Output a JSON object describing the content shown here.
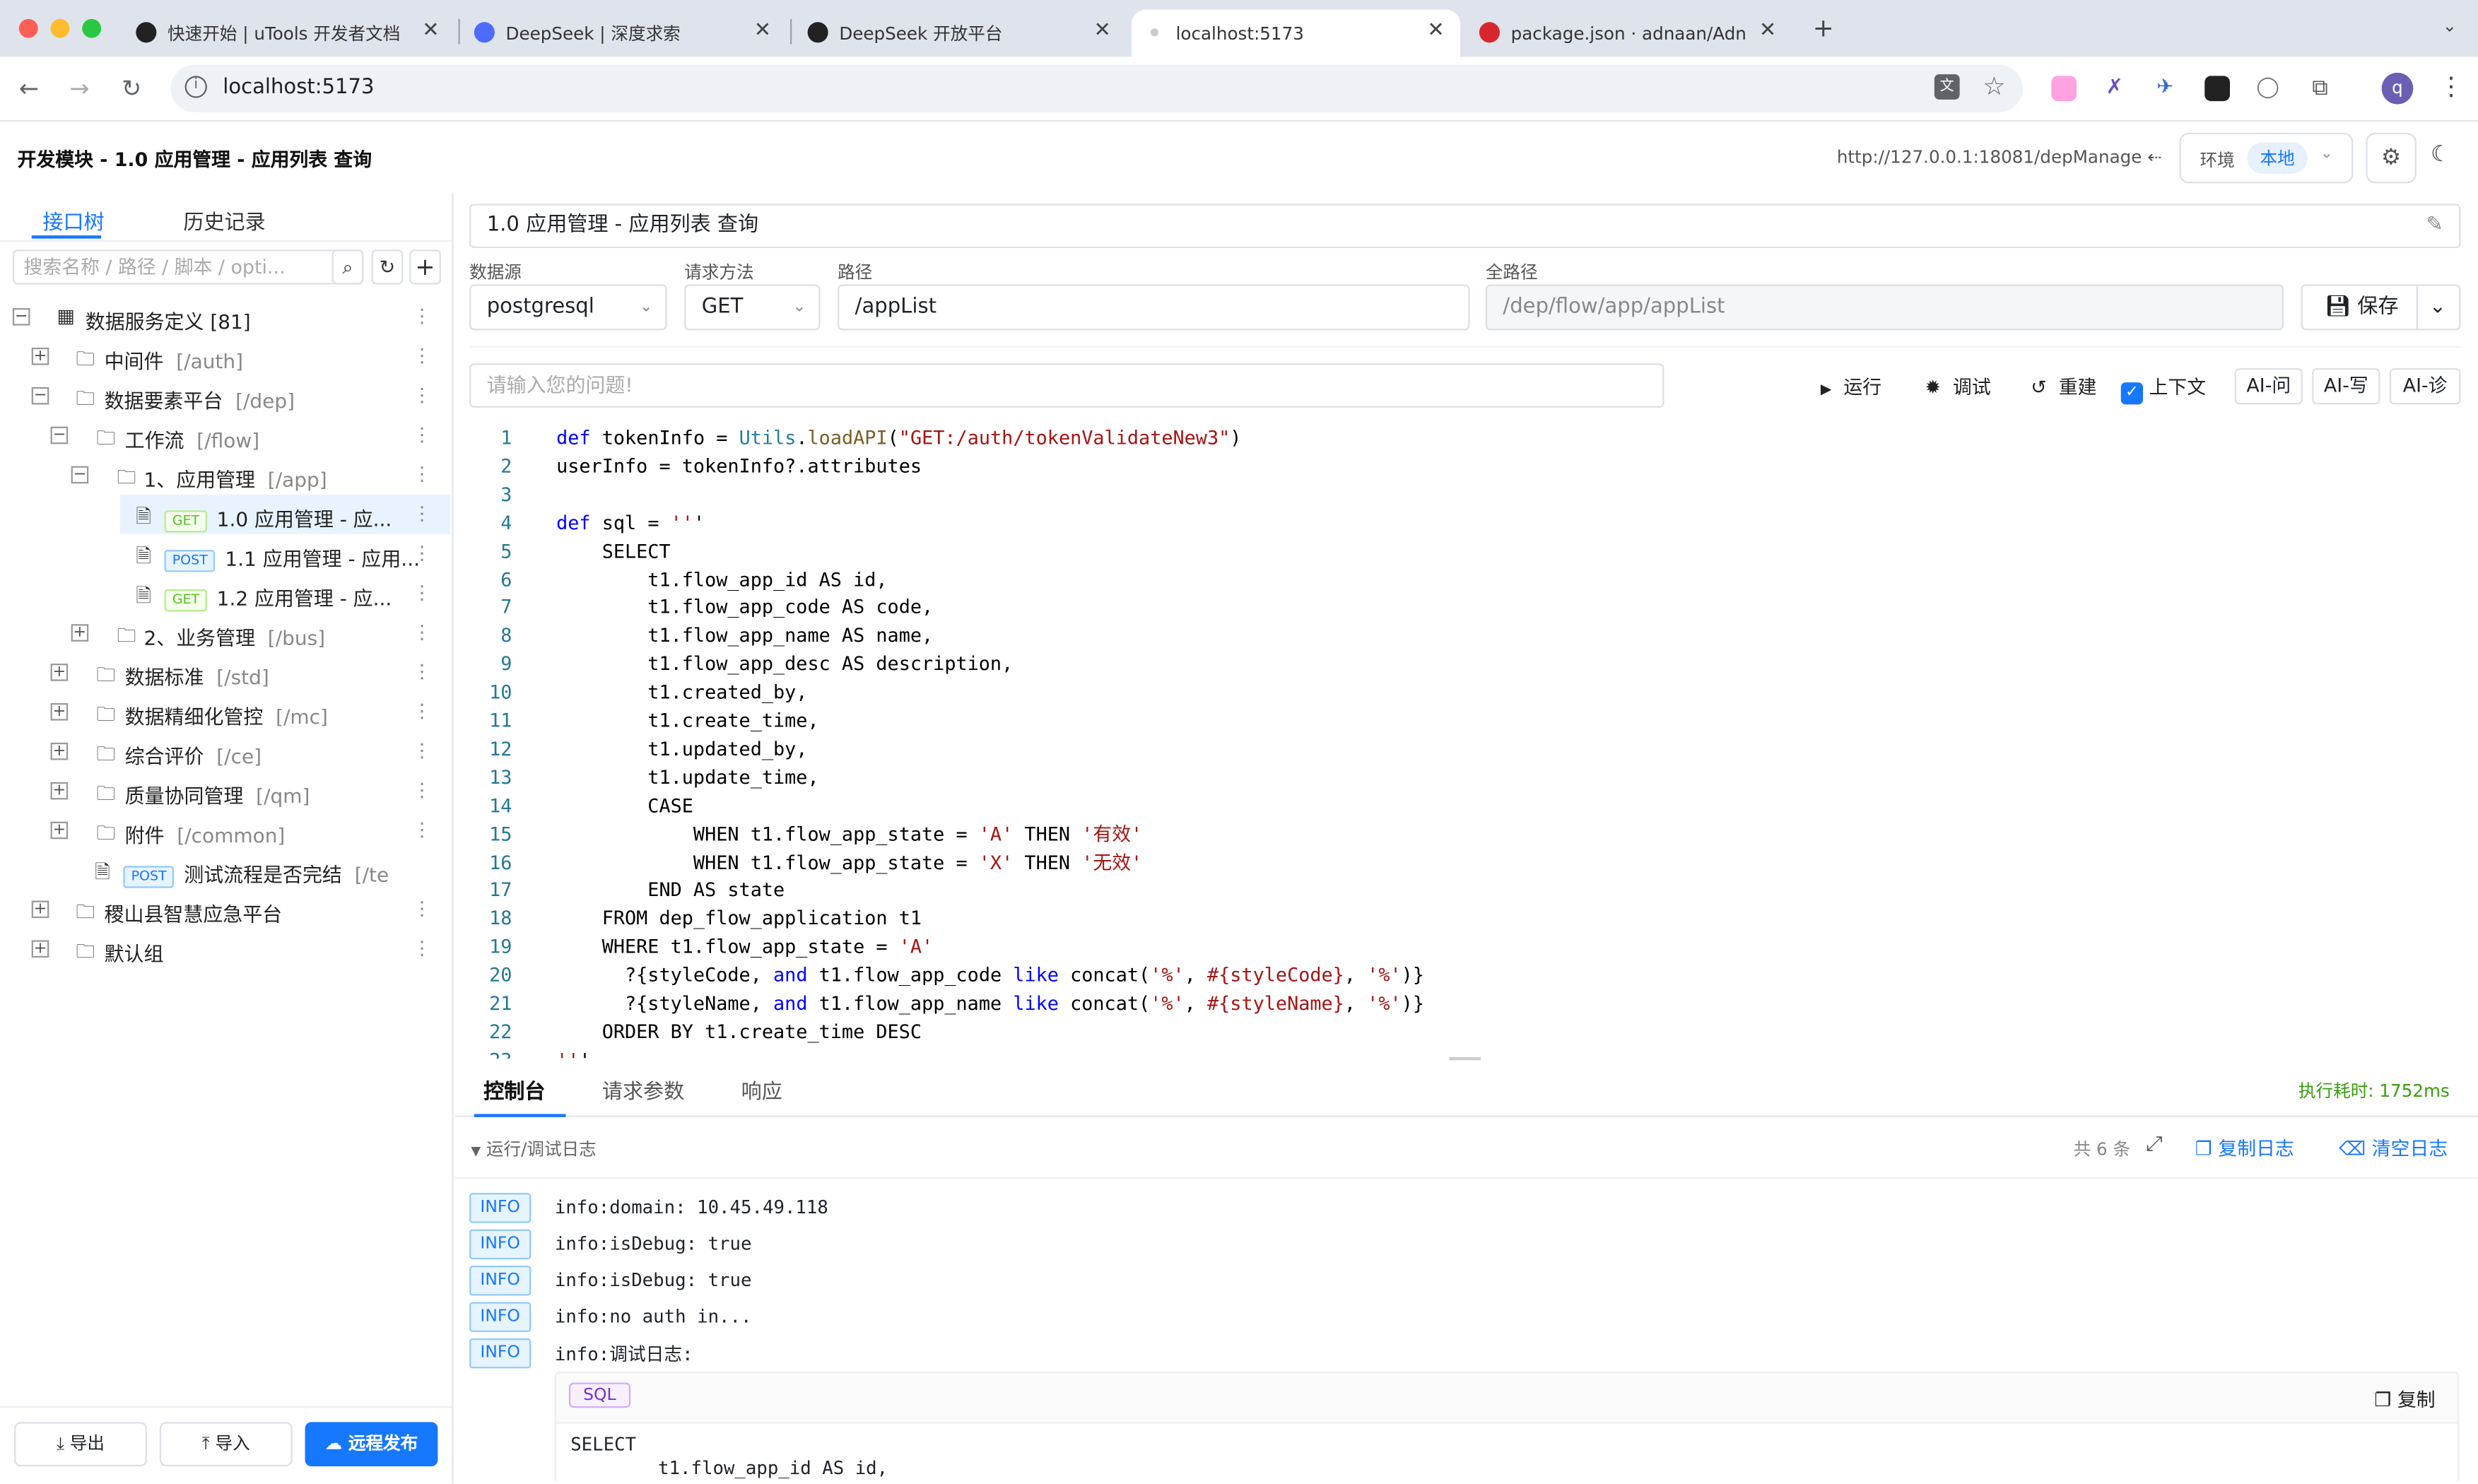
{
  "browser": {
    "tabs": [
      {
        "title": "快速开始 | uTools 开发者文档",
        "fav_color": "#222222"
      },
      {
        "title": "DeepSeek | 深度求索",
        "fav_color": "#4d6bfe"
      },
      {
        "title": "DeepSeek 开放平台",
        "fav_color": "#222222"
      },
      {
        "title": "localhost:5173",
        "fav_color": "#cccccc"
      },
      {
        "title": "package.json · adnaan/Adnify",
        "fav_color": "#d7262d"
      }
    ],
    "url": "localhost:5173",
    "profile_initial": "q"
  },
  "header": {
    "title": "开发模块 - 1.0 应用管理 - 应用列表 查询",
    "api_url": "http://127.0.0.1:18081/depManage",
    "env_label": "环境",
    "env_value": "本地"
  },
  "left": {
    "tabs": [
      "接口树",
      "历史记录"
    ],
    "search_placeholder": "搜索名称 / 路径 / 脚本 / opti...",
    "tree": [
      {
        "label": "数据服务定义 [81]",
        "path": ""
      },
      {
        "label": "中间件",
        "path": "[/auth]"
      },
      {
        "label": "数据要素平台",
        "path": "[/dep]"
      },
      {
        "label": "工作流",
        "path": "[/flow]"
      },
      {
        "label": "1、应用管理",
        "path": "[/app]"
      },
      {
        "method": "GET",
        "label": "1.0 应用管理 - 应...",
        "path": ""
      },
      {
        "method": "POST",
        "label": "1.1 应用管理 - 应用...",
        "path": ""
      },
      {
        "method": "GET",
        "label": "1.2 应用管理 - 应...",
        "path": ""
      },
      {
        "label": "2、业务管理",
        "path": "[/bus]"
      },
      {
        "label": "数据标准",
        "path": "[/std]"
      },
      {
        "label": "数据精细化管控",
        "path": "[/mc]"
      },
      {
        "label": "综合评价",
        "path": "[/ce]"
      },
      {
        "label": "质量协同管理",
        "path": "[/qm]"
      },
      {
        "label": "附件",
        "path": "[/common]"
      },
      {
        "method": "POST",
        "label": "测试流程是否完结",
        "path": "[/te"
      },
      {
        "label": "稷山县智慧应急平台",
        "path": ""
      },
      {
        "label": "默认组",
        "path": ""
      }
    ],
    "buttons": {
      "export": "导出",
      "import": "导入",
      "publish": "远程发布"
    }
  },
  "main": {
    "name": "1.0 应用管理 - 应用列表 查询",
    "fields": {
      "datasource_label": "数据源",
      "datasource_value": "postgresql",
      "method_label": "请求方法",
      "method_value": "GET",
      "path_label": "路径",
      "path_value": "/appList",
      "fullpath_label": "全路径",
      "fullpath_value": "/dep/flow/app/appList"
    },
    "save_label": "保存",
    "ask_placeholder": "请输入您的问题!",
    "actions": {
      "run": "运行",
      "debug": "调试",
      "rebuild": "重建",
      "context": "上下文",
      "context_checked": true,
      "ai_ask": "AI-问",
      "ai_write": "AI-写",
      "ai_diag": "AI-诊"
    }
  },
  "code_lines": [
    "def tokenInfo = Utils.loadAPI(\"GET:/auth/tokenValidateNew3\")",
    "userInfo = tokenInfo?.attributes",
    "",
    "def sql = '''",
    "    SELECT",
    "        t1.flow_app_id AS id,",
    "        t1.flow_app_code AS code,",
    "        t1.flow_app_name AS name,",
    "        t1.flow_app_desc AS description,",
    "        t1.created_by,",
    "        t1.create_time,",
    "        t1.updated_by,",
    "        t1.update_time,",
    "        CASE",
    "            WHEN t1.flow_app_state = 'A' THEN '有效'",
    "            WHEN t1.flow_app_state = 'X' THEN '无效'",
    "        END AS state",
    "    FROM dep_flow_application t1",
    "    WHERE t1.flow_app_state = 'A'",
    "      ?{styleCode, and t1.flow_app_code like concat('%', #{styleCode}, '%')}",
    "      ?{styleName, and t1.flow_app_name like concat('%', #{styleName}, '%')}",
    "    ORDER BY t1.create_time DESC",
    "'''"
  ],
  "bottom": {
    "tabs": [
      "控制台",
      "请求参数",
      "响应"
    ],
    "exec_time": "执行耗时: 1752ms",
    "log_title": "运行/调试日志",
    "log_count": "共 6 条",
    "copy_log": "复制日志",
    "clear_log": "清空日志",
    "logs": [
      {
        "level": "INFO",
        "text": "info:domain: 10.45.49.118"
      },
      {
        "level": "INFO",
        "text": "info:isDebug: true"
      },
      {
        "level": "INFO",
        "text": "info:isDebug: true"
      },
      {
        "level": "INFO",
        "text": "info:no auth in..."
      },
      {
        "level": "INFO",
        "text": "info:调试日志:"
      }
    ],
    "sql_tag": "SQL",
    "sql_copy": "复制",
    "sql_lines": [
      "SELECT",
      "        t1.flow_app_id AS id,"
    ]
  }
}
